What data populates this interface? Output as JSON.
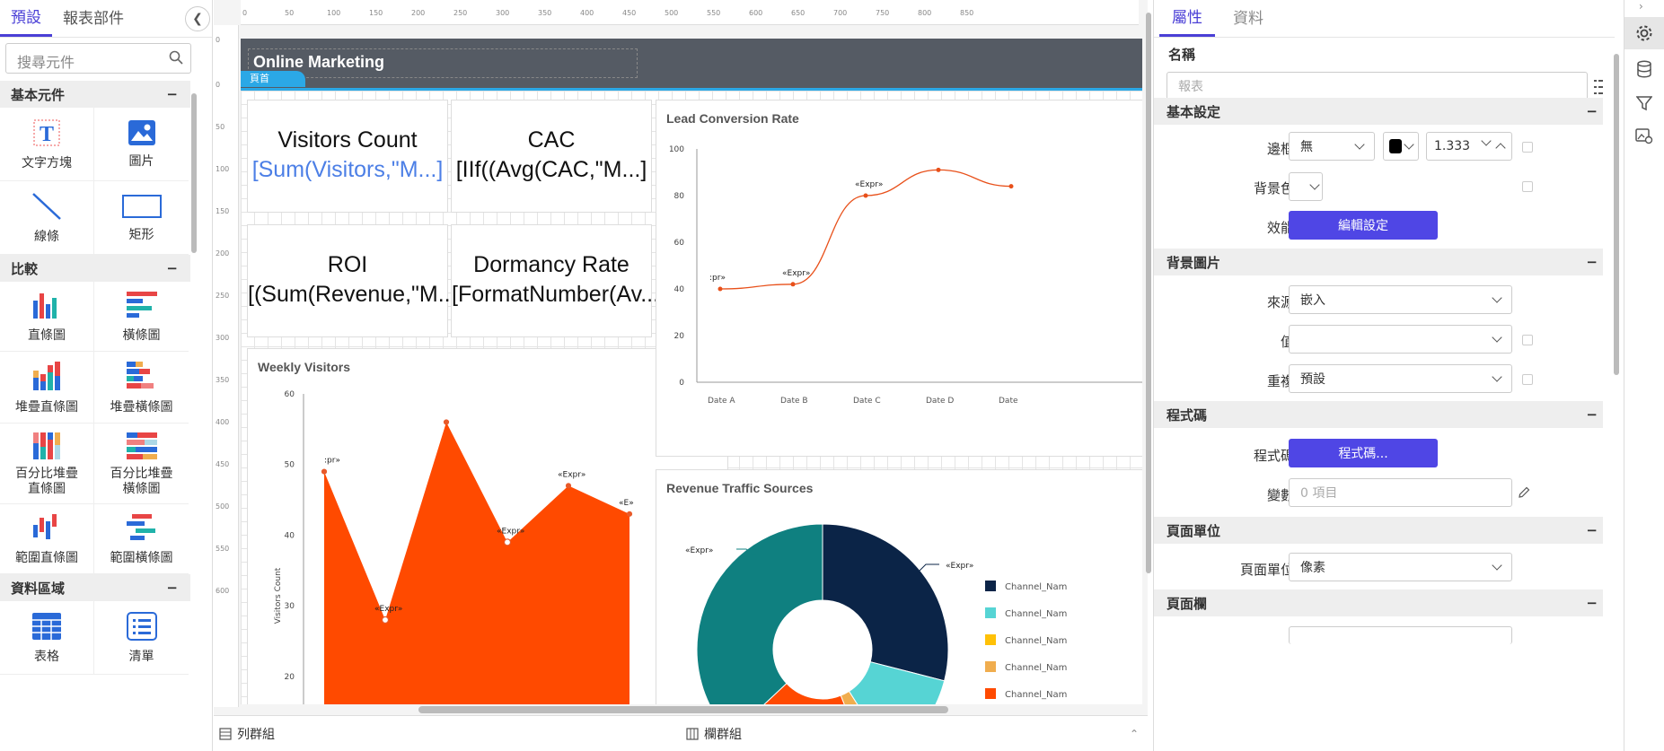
{
  "left_panel": {
    "tabs": [
      {
        "label": "預設",
        "active": true
      },
      {
        "label": "報表部件",
        "active": false
      }
    ],
    "search_placeholder": "搜尋元件",
    "sections": [
      {
        "title": "基本元件",
        "items": [
          {
            "label": "文字方塊",
            "icon": "textbox-icon"
          },
          {
            "label": "圖片",
            "icon": "image-icon"
          },
          {
            "label": "線條",
            "icon": "line-icon"
          },
          {
            "label": "矩形",
            "icon": "rectangle-icon"
          }
        ]
      },
      {
        "title": "比較",
        "items": [
          {
            "label": "直條圖",
            "icon": "column-chart-icon"
          },
          {
            "label": "橫條圖",
            "icon": "bar-chart-icon"
          },
          {
            "label": "堆疊直條圖",
            "icon": "stacked-column-icon"
          },
          {
            "label": "堆疊橫條圖",
            "icon": "stacked-bar-icon"
          },
          {
            "label": "百分比堆疊\n直條圖",
            "icon": "percent-column-icon"
          },
          {
            "label": "百分比堆疊\n橫條圖",
            "icon": "percent-bar-icon"
          },
          {
            "label": "範圍直條圖",
            "icon": "range-column-icon"
          },
          {
            "label": "範圍橫條圖",
            "icon": "range-bar-icon"
          }
        ]
      },
      {
        "title": "資料區域",
        "items": [
          {
            "label": "表格",
            "icon": "table-icon"
          },
          {
            "label": "清單",
            "icon": "list-icon"
          }
        ]
      }
    ],
    "collapse_symbol": "−"
  },
  "canvas": {
    "ruler_top": [
      "0",
      "50",
      "100",
      "150",
      "200",
      "250",
      "300",
      "350",
      "400",
      "450",
      "500",
      "550",
      "600",
      "650",
      "700",
      "750",
      "800",
      "850"
    ],
    "ruler_left": [
      "0",
      "0",
      "50",
      "100",
      "150",
      "200",
      "250",
      "300",
      "350",
      "400",
      "450",
      "500",
      "550",
      "600"
    ],
    "header": {
      "title": "Online Marketing",
      "tag": "頁首"
    },
    "kpis": [
      {
        "title": "Visitors Count",
        "value": "[Sum(Visitors,\"M...]",
        "link": true
      },
      {
        "title": "CAC",
        "value": "[IIf((Avg(CAC,\"M...]",
        "link": false
      },
      {
        "title": "ROI",
        "value": "[(Sum(Revenue,\"M...]",
        "link": false
      },
      {
        "title": "Dormancy Rate",
        "value": "[FormatNumber(Av...]",
        "link": false
      }
    ],
    "bottom_bar": {
      "rows_group": "列群組",
      "cols_group": "欄群組"
    }
  },
  "chart_data": [
    {
      "type": "area",
      "title": "Weekly Visitors",
      "ylabel": "Visitors Count",
      "y_ticks": [
        "20",
        "30",
        "40",
        "50",
        "60"
      ],
      "ylim": [
        13,
        60
      ],
      "values": [
        49,
        28,
        56,
        39,
        47,
        43
      ],
      "point_labels": [
        ":pr»",
        "«Expr»",
        "",
        "«Expr»",
        "«Expr»",
        "«E»"
      ],
      "color": "#ff4a00"
    },
    {
      "type": "line",
      "title": "Lead Conversion Rate",
      "categories": [
        "Date A",
        "Date B",
        "Date C",
        "Date D",
        "Date"
      ],
      "y_ticks": [
        "0",
        "20",
        "40",
        "60",
        "80",
        "100"
      ],
      "ylim": [
        0,
        100
      ],
      "values": [
        40,
        42,
        80,
        91,
        84
      ],
      "point_labels": [
        ":pr»",
        "«Expr»",
        "«Expr»",
        "",
        ""
      ],
      "color": "#e8501a"
    },
    {
      "type": "pie",
      "title": "Revenue Traffic Sources",
      "slices": [
        {
          "value": 29,
          "color": "#0b2447"
        },
        {
          "value": 12,
          "color": "#56d4d4"
        },
        {
          "value": 3,
          "color": "#f0ad4e"
        },
        {
          "value": 19,
          "color": "#ff4a00"
        },
        {
          "value": 37,
          "color": "#0f8080"
        }
      ],
      "slice_labels": [
        "«Expr»",
        "«Expr»"
      ],
      "legend": [
        {
          "label": "Channel_Nam",
          "color": "#0b2447"
        },
        {
          "label": "Channel_Nam",
          "color": "#56d4d4"
        },
        {
          "label": "Channel_Nam",
          "color": "#ffc107"
        },
        {
          "label": "Channel_Nam",
          "color": "#f0ad4e"
        },
        {
          "label": "Channel_Nam",
          "color": "#ff4a00"
        }
      ]
    }
  ],
  "right_panel": {
    "tabs": [
      {
        "label": "屬性",
        "active": true
      },
      {
        "label": "資料",
        "active": false
      }
    ],
    "name_label": "名稱",
    "name_placeholder": "報表",
    "sections": {
      "basic": "基本設定",
      "bg_image": "背景圖片",
      "code": "程式碼",
      "page_unit": "頁面單位",
      "page_margin": "頁面欄"
    },
    "border": {
      "label": "邊框",
      "style": "無",
      "color": "#000000",
      "width": "1.333"
    },
    "bg_color": {
      "label": "背景色"
    },
    "effect": {
      "label": "效能",
      "button": "編輯設定"
    },
    "source": {
      "label": "來源",
      "value": "嵌入"
    },
    "value": {
      "label": "值",
      "value": ""
    },
    "repeat": {
      "label": "重複",
      "value": "預設"
    },
    "code": {
      "label": "程式碼",
      "button": "程式碼..."
    },
    "variables": {
      "label": "變數",
      "placeholder": "0 項目"
    },
    "page_unit": {
      "label": "頁面單位",
      "value": "像素"
    },
    "collapse_symbol": "−"
  },
  "icon_bar": [
    {
      "icon": "gear-icon",
      "active": true
    },
    {
      "icon": "database-icon",
      "active": false
    },
    {
      "icon": "filter-icon",
      "active": false
    },
    {
      "icon": "image-settings-icon",
      "active": false
    }
  ]
}
